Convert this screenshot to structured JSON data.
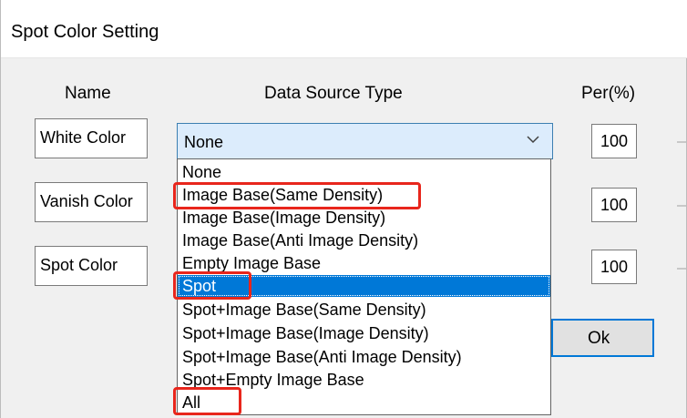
{
  "window": {
    "title": "Spot Color Setting"
  },
  "headers": {
    "name": "Name",
    "data_source_type": "Data Source Type",
    "per": "Per(%)"
  },
  "rows": [
    {
      "name": "White Color",
      "per": "100"
    },
    {
      "name": "Vanish Color",
      "per": "100"
    },
    {
      "name": "Spot Color",
      "per": "100"
    }
  ],
  "combo": {
    "value": "None",
    "arrow_icon": "chevron-down-icon"
  },
  "dropdown": {
    "options": [
      "None",
      "Image Base(Same Density)",
      "Image Base(Image Density)",
      "Image Base(Anti Image Density)",
      "Empty Image Base",
      "Spot",
      "Spot+Image Base(Same Density)",
      "Spot+Image Base(Image Density)",
      "Spot+Image Base(Anti Image Density)",
      "Spot+Empty Image Base",
      "All"
    ],
    "selected": "Spot",
    "highlighted_options": [
      "Image Base(Same Density)",
      "Spot",
      "All"
    ]
  },
  "ok_button": {
    "label": "Ok"
  },
  "colors": {
    "selection": "#0078d7",
    "highlight_box": "#e8261c",
    "combo_background": "#dcecfc",
    "dialog_background": "#f0f0f0"
  }
}
